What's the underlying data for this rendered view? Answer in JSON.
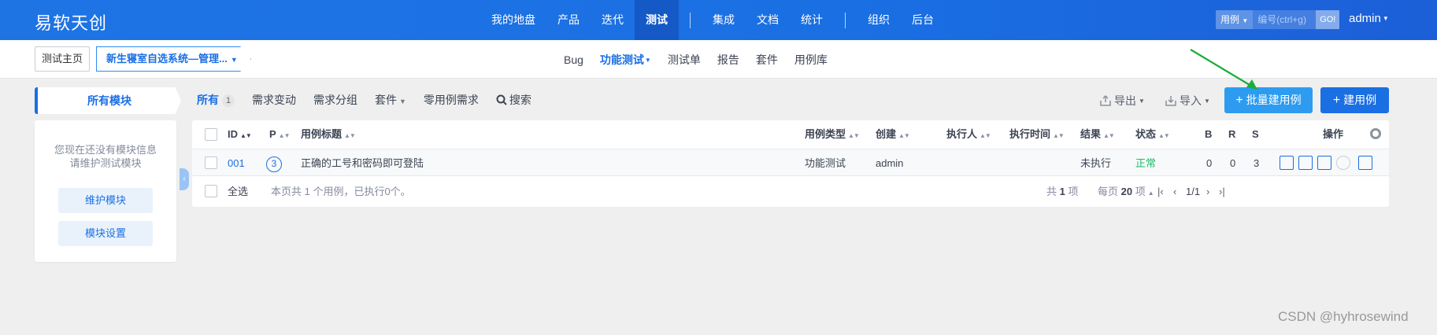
{
  "header": {
    "logo": "易软天创",
    "nav": [
      "我的地盘",
      "产品",
      "迭代",
      "测试",
      "集成",
      "文档",
      "统计",
      "组织",
      "后台"
    ],
    "search_type": "用例",
    "search_placeholder": "编号(ctrl+g)",
    "go_label": "GO!",
    "user": "admin"
  },
  "subbar": {
    "crumb_home": "测试主页",
    "crumb_product": "新生寝室自选系统—管理...",
    "nav": [
      "Bug",
      "功能测试",
      "测试单",
      "报告",
      "套件",
      "用例库"
    ]
  },
  "sidebar": {
    "head": "所有模块",
    "empty_line1": "您现在还没有模块信息",
    "empty_line2": "请维护测试模块",
    "btn_maintain": "维护模块",
    "btn_settings": "模块设置"
  },
  "featurebar": {
    "all": "所有",
    "all_count": "1",
    "items": [
      "需求变动",
      "需求分组",
      "套件",
      "零用例需求"
    ],
    "search": "搜索",
    "export": "导出",
    "import": "导入",
    "batch_create": "批量建用例",
    "create": "建用例"
  },
  "table": {
    "headers": {
      "id": "ID",
      "p": "P",
      "title": "用例标题",
      "type": "用例类型",
      "creator": "创建",
      "executor": "执行人",
      "exec_time": "执行时间",
      "result": "结果",
      "status": "状态",
      "b": "B",
      "r": "R",
      "s": "S",
      "actions": "操作"
    },
    "rows": [
      {
        "id": "001",
        "p": "3",
        "title": "正确的工号和密码即可登陆",
        "type": "功能测试",
        "creator": "admin",
        "executor": "",
        "exec_time": "",
        "result": "未执行",
        "status": "正常",
        "b": "0",
        "r": "0",
        "s": "3"
      }
    ],
    "footer": {
      "select_all": "全选",
      "summary": "本页共 1 个用例，已执行0个。",
      "total_pre": "共",
      "total": "1",
      "total_post": "项",
      "per_pre": "每页",
      "per": "20",
      "per_post": "项",
      "pages": "1/1"
    }
  },
  "watermark": "CSDN @hyhrosewind",
  "colors": {
    "brand": "#1a6fe3",
    "status_normal": "#19be6b",
    "arrow": "#1aae3c"
  }
}
